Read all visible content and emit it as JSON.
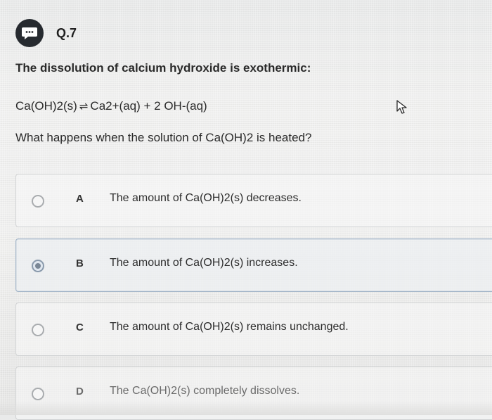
{
  "question": {
    "badge_icon": "chat-bubble-icon",
    "number": "Q.7",
    "statement": "The dissolution of calcium hydroxide is exothermic:",
    "equation": {
      "left": "Ca(OH)2(s)",
      "arrow": "⇌",
      "right": "Ca2+(aq) + 2 OH-(aq)"
    },
    "prompt": "What happens when the solution of Ca(OH)2 is heated?"
  },
  "options": [
    {
      "letter": "A",
      "text": "The amount of Ca(OH)2(s) decreases.",
      "selected": false
    },
    {
      "letter": "B",
      "text": "The amount of Ca(OH)2(s) increases.",
      "selected": true
    },
    {
      "letter": "C",
      "text": "The amount of Ca(OH)2(s) remains unchanged.",
      "selected": false
    },
    {
      "letter": "D",
      "text": "The Ca(OH)2(s) completely dissolves.",
      "selected": false
    }
  ],
  "colors": {
    "badge": "#262a2f",
    "selected_border": "#9fb2c6",
    "option_border": "#cfd1d2"
  }
}
